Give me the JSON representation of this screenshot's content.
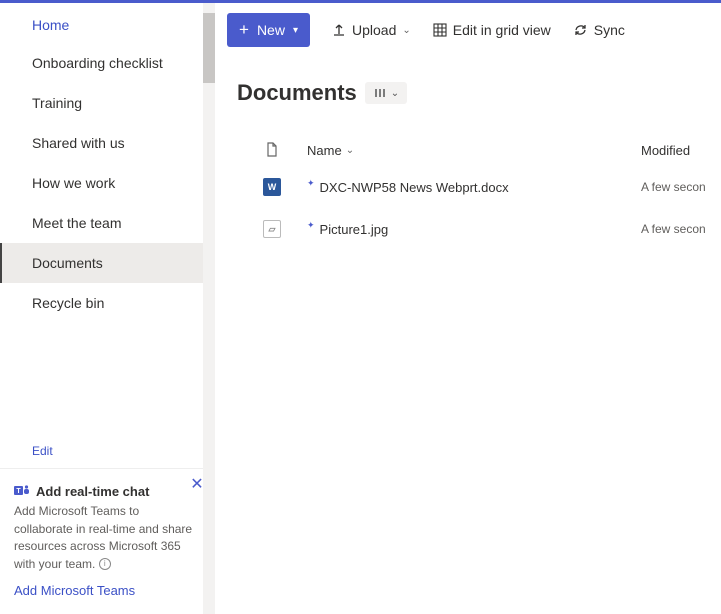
{
  "sidebar": {
    "nav": [
      {
        "label": "Home",
        "state": "home"
      },
      {
        "label": "Onboarding checklist",
        "state": ""
      },
      {
        "label": "Training",
        "state": ""
      },
      {
        "label": "Shared with us",
        "state": ""
      },
      {
        "label": "How we work",
        "state": ""
      },
      {
        "label": "Meet the team",
        "state": ""
      },
      {
        "label": "Documents",
        "state": "active"
      },
      {
        "label": "Recycle bin",
        "state": ""
      }
    ],
    "edit": "Edit"
  },
  "promo": {
    "title": "Add real-time chat",
    "body": "Add Microsoft Teams to collaborate in real-time and share resources across Microsoft 365 with your team.",
    "link": "Add Microsoft Teams"
  },
  "toolbar": {
    "new": "New",
    "upload": "Upload",
    "editgrid": "Edit in grid view",
    "sync": "Sync"
  },
  "page": {
    "title": "Documents"
  },
  "cols": {
    "name": "Name",
    "modified": "Modified"
  },
  "rows": [
    {
      "icon": "doc",
      "name": "DXC-NWP58 News Webprt.docx",
      "modified": "A few secon",
      "isNew": true
    },
    {
      "icon": "img",
      "name": "Picture1.jpg",
      "modified": "A few secon",
      "isNew": true
    }
  ]
}
